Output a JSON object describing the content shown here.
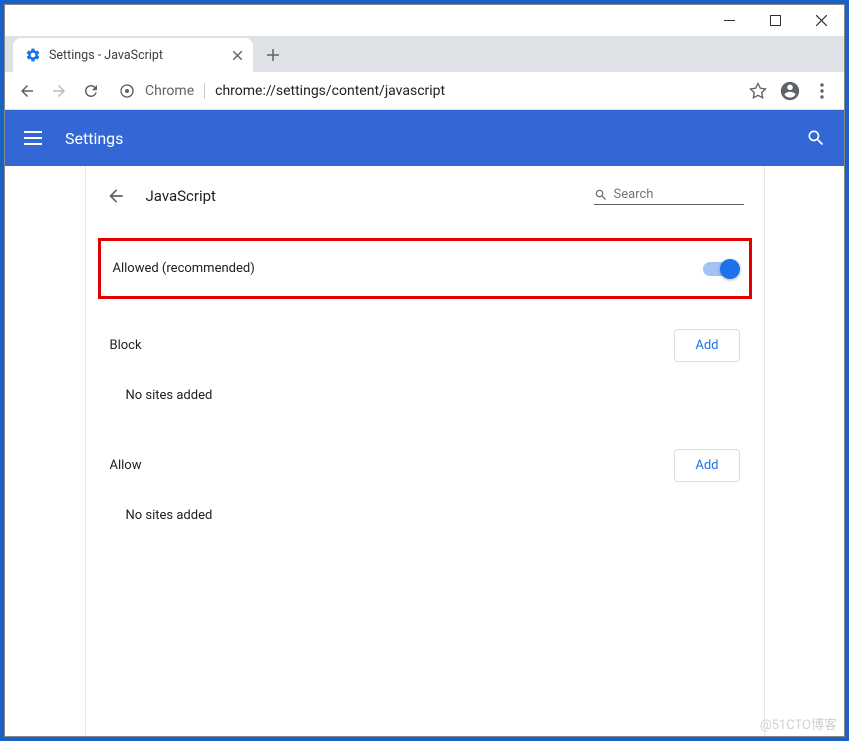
{
  "window": {
    "tab_title": "Settings - JavaScript"
  },
  "omnibox": {
    "protocol_label": "Chrome",
    "url": "chrome://settings/content/javascript"
  },
  "appbar": {
    "title": "Settings"
  },
  "page": {
    "title": "JavaScript",
    "search_placeholder": "Search",
    "toggle_label": "Allowed (recommended)",
    "toggle_on": true,
    "sections": {
      "block": {
        "title": "Block",
        "add_label": "Add",
        "empty": "No sites added"
      },
      "allow": {
        "title": "Allow",
        "add_label": "Add",
        "empty": "No sites added"
      }
    }
  },
  "watermark": "@51CTO博客"
}
